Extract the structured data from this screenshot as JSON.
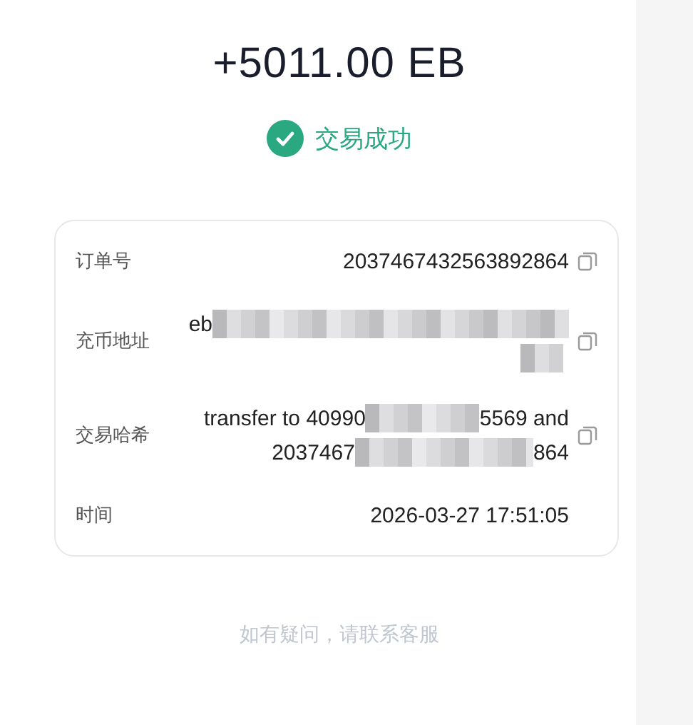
{
  "amount": "+5011.00 EB",
  "status": {
    "text": "交易成功",
    "kind": "success"
  },
  "details": [
    {
      "label": "订单号",
      "lines": [
        [
          {
            "kind": "text",
            "text": "2037467432563892864"
          }
        ]
      ],
      "copyable": true
    },
    {
      "label": "充币地址",
      "lines": [
        [
          {
            "kind": "text",
            "text": "eb"
          },
          {
            "kind": "redacted"
          }
        ],
        [
          {
            "kind": "redacted"
          }
        ]
      ],
      "copyable": true
    },
    {
      "label": "交易哈希",
      "lines": [
        [
          {
            "kind": "text",
            "text": "transfer to 40990"
          },
          {
            "kind": "redacted"
          },
          {
            "kind": "text",
            "text": "5569 and"
          }
        ],
        [
          {
            "kind": "text",
            "text": "2037467"
          },
          {
            "kind": "redacted"
          },
          {
            "kind": "text",
            "text": "864"
          }
        ]
      ],
      "copyable": true
    },
    {
      "label": "时间",
      "lines": [
        [
          {
            "kind": "text",
            "text": "2026-03-27 17:51:05"
          }
        ]
      ],
      "copyable": false
    }
  ],
  "footer": "如有疑问，请联系客服"
}
